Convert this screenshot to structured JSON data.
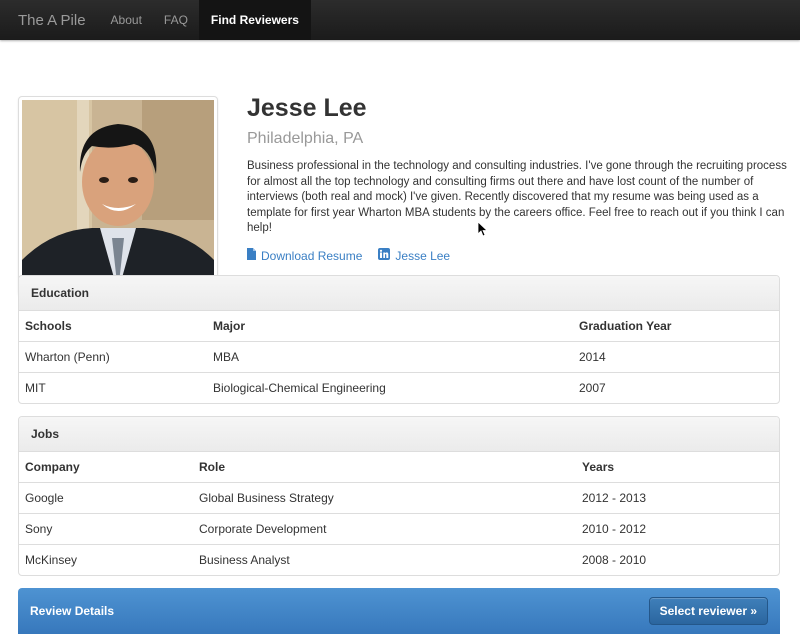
{
  "nav": {
    "brand": "The A Pile",
    "items": [
      {
        "label": "About"
      },
      {
        "label": "FAQ"
      },
      {
        "label": "Find Reviewers"
      }
    ]
  },
  "profile": {
    "name": "Jesse Lee",
    "location": "Philadelphia, PA",
    "bio": "Business professional in the technology and consulting industries. I've gone through the recruiting process for almost all the top technology and consulting firms out there and have lost count of the number of interviews (both real and mock) I've given. Recently discovered that my resume was being used as a template for first year Wharton MBA students by the careers office. Feel free to reach out if you think I can help!",
    "links": {
      "resume_label": "Download Resume",
      "linkedin_label": "Jesse Lee"
    }
  },
  "education": {
    "title": "Education",
    "headers": [
      "Schools",
      "Major",
      "Graduation Year"
    ],
    "rows": [
      [
        "Wharton (Penn)",
        "MBA",
        "2014"
      ],
      [
        "MIT",
        "Biological-Chemical Engineering",
        "2007"
      ]
    ]
  },
  "jobs": {
    "title": "Jobs",
    "headers": [
      "Company",
      "Role",
      "Years"
    ],
    "rows": [
      [
        "Google",
        "Global Business Strategy",
        "2012 - 2013"
      ],
      [
        "Sony",
        "Corporate Development",
        "2010 - 2012"
      ],
      [
        "McKinsey",
        "Business Analyst",
        "2008 - 2010"
      ]
    ]
  },
  "review": {
    "title": "Review Details",
    "button_label": "Select reviewer »"
  },
  "colors": {
    "accent": "#3a7fc4",
    "navbar": "#222222",
    "review_bar": "#428bca"
  }
}
